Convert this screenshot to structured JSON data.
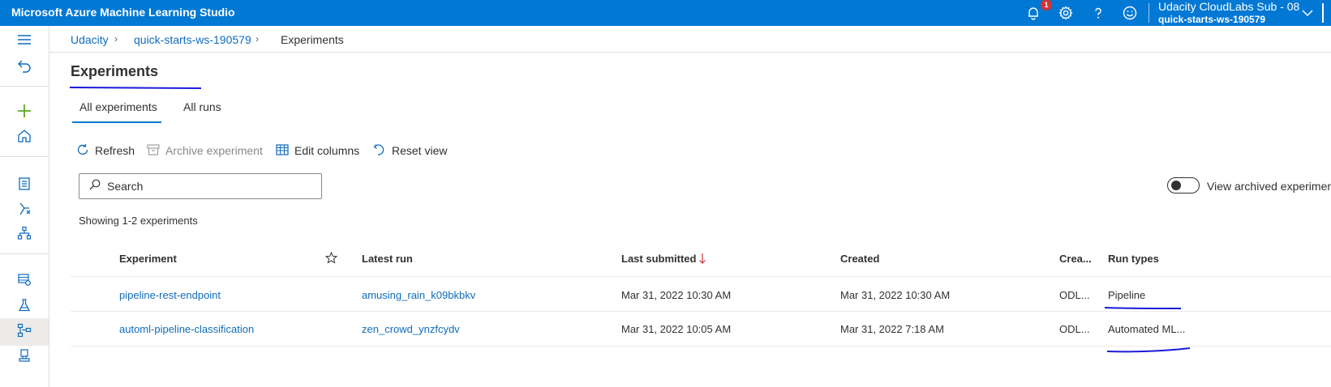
{
  "topbar": {
    "title": "Microsoft Azure Machine Learning Studio",
    "notification_count": "1",
    "account_name": "Udacity CloudLabs Sub - 08",
    "workspace": "quick-starts-ws-190579"
  },
  "breadcrumb": {
    "items": [
      "Udacity",
      "quick-starts-ws-190579",
      "Experiments"
    ]
  },
  "page": {
    "title": "Experiments",
    "tabs": [
      {
        "label": "All experiments",
        "active": true
      },
      {
        "label": "All runs",
        "active": false
      }
    ]
  },
  "toolbar": {
    "refresh": "Refresh",
    "archive": "Archive experiment",
    "edit_columns": "Edit columns",
    "reset_view": "Reset view"
  },
  "search": {
    "placeholder": "Search"
  },
  "archived_toggle": {
    "label": "View archived experimen",
    "on": false
  },
  "showing": "Showing 1-2 experiments",
  "table": {
    "columns": [
      "Experiment",
      "Latest run",
      "Last submitted",
      "Created",
      "Crea...",
      "Run types"
    ],
    "rows": [
      {
        "experiment": "pipeline-rest-endpoint",
        "latest_run": "amusing_rain_k09bkbkv",
        "last_submitted": "Mar 31, 2022 10:30 AM",
        "created": "Mar 31, 2022 10:30 AM",
        "creator": "ODL...",
        "run_types": "Pipeline"
      },
      {
        "experiment": "automl-pipeline-classification",
        "latest_run": "zen_crowd_ynzfcydv",
        "last_submitted": "Mar 31, 2022 10:05 AM",
        "created": "Mar 31, 2022 7:18 AM",
        "creator": "ODL...",
        "run_types": "Automated ML..."
      }
    ]
  },
  "colors": {
    "topbar": "#0078d4",
    "link": "#0f6cbd",
    "annotation_ink": "#1a1adb"
  }
}
